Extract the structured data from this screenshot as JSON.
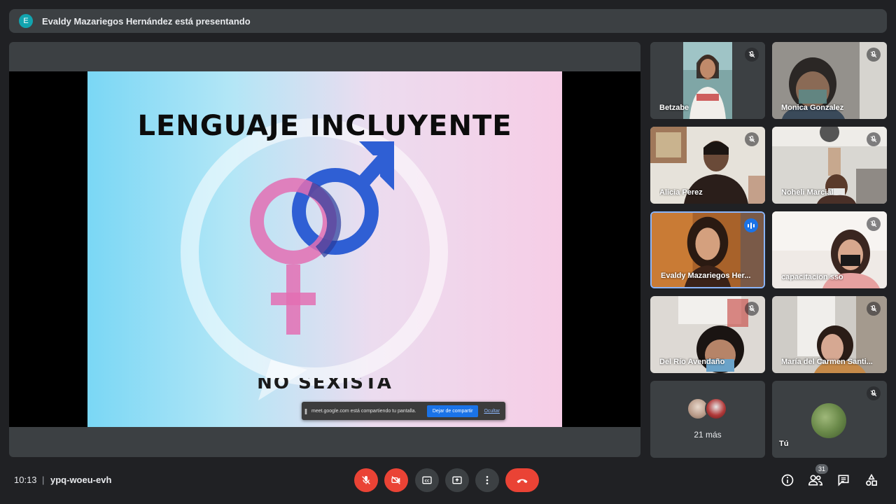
{
  "top_bar": {
    "avatar_letter": "E",
    "presenting_text": "Evaldy Mazariegos Hernández está presentando"
  },
  "slide": {
    "title": "LENGUAJE INCLUYENTE",
    "subtitle": "NO SEXISTA",
    "share_bar": {
      "text": "meet.google.com está compartiendo tu pantalla.",
      "stop_label": "Dejar de compartir",
      "hide_label": "Ocultar"
    }
  },
  "participants": [
    {
      "name": "Betzabe",
      "muted": true
    },
    {
      "name": "Monica Gonzalez",
      "muted": true
    },
    {
      "name": "Alicia Perez",
      "muted": true
    },
    {
      "name": "Noheli Marcial",
      "muted": true
    },
    {
      "name": "Evaldy Mazariegos Her...",
      "muted": false,
      "speaking": true
    },
    {
      "name": "capacitacion sso",
      "muted": true
    },
    {
      "name": "Del Río Avendaño",
      "muted": true
    },
    {
      "name": "María del Carmen Santi...",
      "muted": true
    }
  ],
  "more_tile": {
    "label": "21 más"
  },
  "self_tile": {
    "name": "Tú",
    "muted": true
  },
  "meeting": {
    "time": "10:13",
    "separator": "|",
    "code": "ypq-woeu-evh",
    "participant_count": "31"
  },
  "controls": {
    "mic": "mic-off-icon",
    "camera": "camera-off-icon",
    "captions": "captions-icon",
    "present": "present-screen-icon",
    "more": "more-options-icon",
    "end_call": "end-call-icon"
  },
  "colors": {
    "background": "#202124",
    "panel": "#3c4043",
    "danger": "#ea4335",
    "accent": "#1a73e8",
    "avatar_teal": "#12a4af"
  }
}
